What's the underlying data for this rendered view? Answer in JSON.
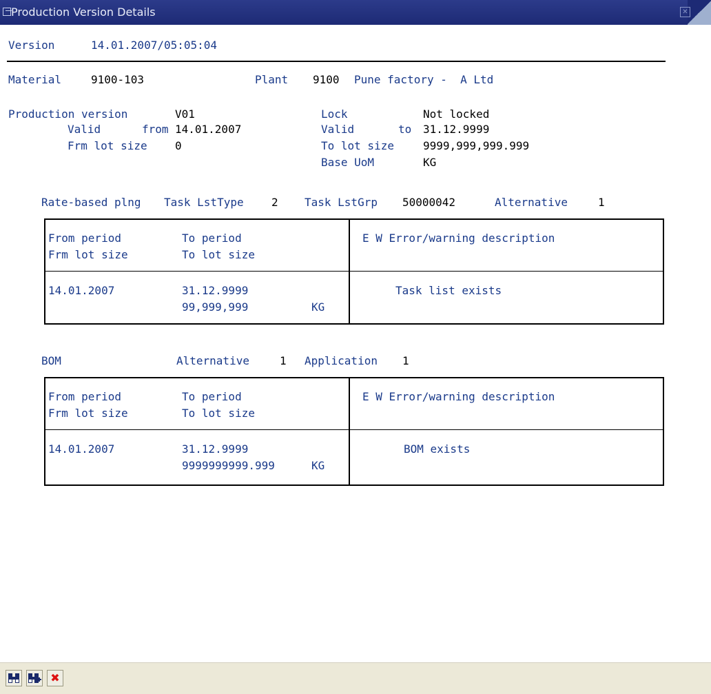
{
  "window": {
    "title": "Production Version Details"
  },
  "header": {
    "version_label": "Version",
    "version_value": "14.01.2007/05:05:04"
  },
  "material": {
    "label": "Material",
    "value": "9100-103"
  },
  "plant": {
    "label": "Plant",
    "code": "9100",
    "name": "Pune factory -  A Ltd"
  },
  "prodver": {
    "label": "Production version",
    "value": "V01",
    "valid_label": "Valid",
    "from_label": "from",
    "from_value": "14.01.2007",
    "frm_lot_label": "Frm lot size",
    "frm_lot_value": "0",
    "lock_label": "Lock",
    "lock_value": "Not locked",
    "valid_to_label": "Valid",
    "to_label": "to",
    "to_value": "31.12.9999",
    "to_lot_label": "To lot size",
    "to_lot_value": "9999,999,999.999",
    "base_uom_label": "Base UoM",
    "base_uom_value": "KG"
  },
  "rate": {
    "heading": "Rate-based plng",
    "tasktype_label": "Task LstType",
    "tasktype_value": "2",
    "taskgrp_label": "Task LstGrp",
    "taskgrp_value": "50000042",
    "alt_label": "Alternative",
    "alt_value": "1",
    "table": {
      "col_from": "From period",
      "col_frm_lot": "Frm lot size",
      "col_to": "To period",
      "col_to_lot": "To lot size",
      "col_ew": "E W Error/warning description",
      "from_value": "14.01.2007",
      "to_value": "31.12.9999",
      "lot_value": "99,999,999",
      "uom": "KG",
      "message": "Task list exists"
    }
  },
  "bom": {
    "heading": "BOM",
    "alt_label": "Alternative",
    "alt_value": "1",
    "app_label": "Application",
    "app_value": "1",
    "table": {
      "col_from": "From period",
      "col_frm_lot": "Frm lot size",
      "col_to": "To period",
      "col_to_lot": "To lot size",
      "col_ew": "E W Error/warning description",
      "from_value": "14.01.2007",
      "to_value": "31.12.9999",
      "lot_value": "9999999999.999",
      "uom": "KG",
      "message": "BOM exists"
    }
  },
  "toolbar": {
    "find_icon": "binoculars-icon",
    "find_next_icon": "binoculars-plus-icon",
    "cancel_icon": "red-x-icon"
  }
}
